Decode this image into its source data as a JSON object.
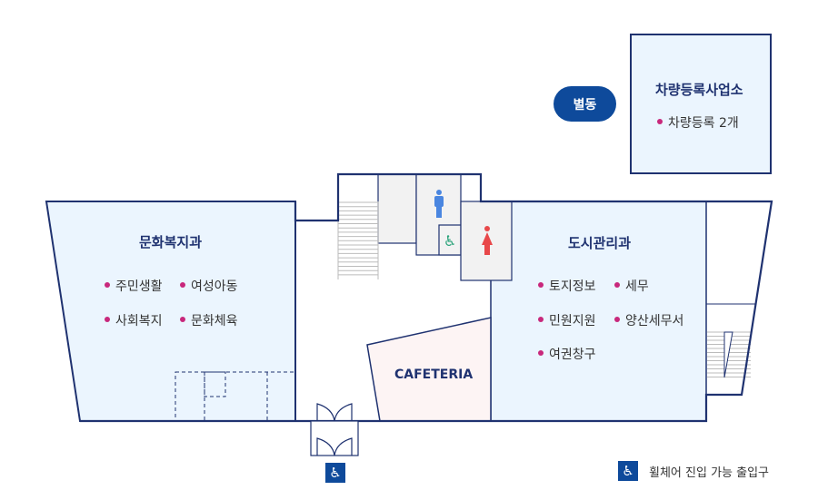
{
  "annex": {
    "badge": "별동",
    "title": "차량등록사업소",
    "items": [
      "차량등록 2개"
    ]
  },
  "left_room": {
    "title": "문화복지과",
    "items": [
      "주민생활",
      "여성아동",
      "사회복지",
      "문화체육"
    ]
  },
  "right_room": {
    "title": "도시관리과",
    "items": [
      "토지정보",
      "세무",
      "민원지원",
      "양산세무서",
      "여권창구"
    ]
  },
  "cafeteria": {
    "label": "CAFETERIA"
  },
  "legend": {
    "icon": "wheelchair-icon",
    "label": "휠체어 진입 가능 출입구"
  },
  "colors": {
    "outline": "#1f3270",
    "room_fill": "#ebf5fe",
    "cafeteria_fill": "#fdf4f4",
    "accent": "#0e4a9b",
    "bullet": "#c8287c",
    "men": "#4a86e0",
    "women": "#e8484a",
    "accessible": "#2aa37a"
  }
}
